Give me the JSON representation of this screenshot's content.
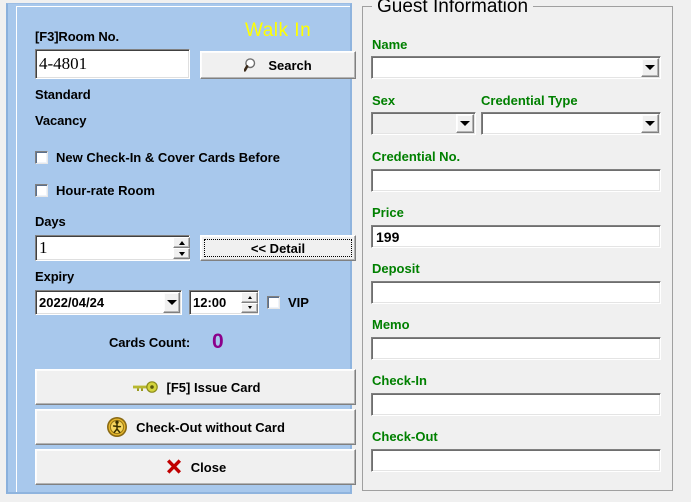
{
  "left": {
    "room_no_label": "[F3]Room No.",
    "walk_in_label": "Walk In",
    "room_no_value": "4-4801",
    "search_button": "Search",
    "room_type": "Standard",
    "room_status": "Vacancy",
    "checkbox_new_checkin": "New Check-In & Cover Cards Before",
    "checkbox_hour_rate": "Hour-rate Room",
    "days_label": "Days",
    "days_value": "1",
    "detail_button": "<< Detail",
    "expiry_label": "Expiry",
    "expiry_date": "2022/04/24",
    "expiry_time": "12:00",
    "vip_label": "VIP",
    "cards_count_label": "Cards Count:",
    "cards_count_value": "0",
    "cards_count_color": "#8b008b",
    "issue_card_button": "[F5] Issue Card",
    "checkout_button": "Check-Out without Card",
    "close_button": "Close"
  },
  "right": {
    "group_title": "Guest Information",
    "label_color": "#008000",
    "name_label": "Name",
    "name_value": "",
    "sex_label": "Sex",
    "sex_value": "",
    "credential_type_label": "Credential Type",
    "credential_type_value": "",
    "credential_no_label": "Credential No.",
    "credential_no_value": "",
    "price_label": "Price",
    "price_value": "199",
    "deposit_label": "Deposit",
    "deposit_value": "",
    "memo_label": "Memo",
    "memo_value": "",
    "checkin_label": "Check-In",
    "checkin_value": "",
    "checkout_label": "Check-Out",
    "checkout_value": ""
  }
}
